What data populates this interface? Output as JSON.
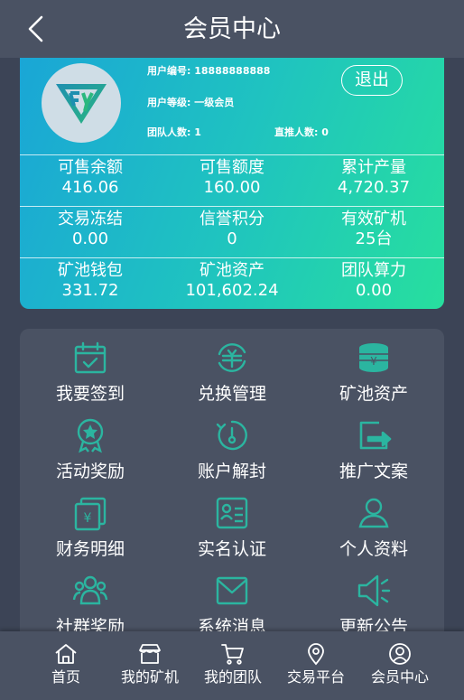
{
  "header": {
    "title": "会员中心"
  },
  "profile": {
    "user_id_label": "用户编号:",
    "user_id": "18888888888",
    "level_label": "用户等级:",
    "level": "一级会员",
    "team_label": "团队人数:",
    "team_count": "1",
    "direct_label": "直推人数:",
    "direct_count": "0",
    "logout_label": "退出"
  },
  "stats": [
    {
      "label": "可售余额",
      "value": "416.06"
    },
    {
      "label": "可售额度",
      "value": "160.00"
    },
    {
      "label": "累计产量",
      "value": "4,720.37"
    },
    {
      "label": "交易冻结",
      "value": "0.00"
    },
    {
      "label": "信誉积分",
      "value": "0"
    },
    {
      "label": "有效矿机",
      "value": "25台"
    },
    {
      "label": "矿池钱包",
      "value": "331.72"
    },
    {
      "label": "矿池资产",
      "value": "101,602.24"
    },
    {
      "label": "团队算力",
      "value": "0.00"
    }
  ],
  "menu": [
    {
      "label": "我要签到",
      "icon": "calendar-check-icon"
    },
    {
      "label": "兑换管理",
      "icon": "exchange-icon"
    },
    {
      "label": "矿池资产",
      "icon": "coin-stack-icon"
    },
    {
      "label": "活动奖励",
      "icon": "medal-icon"
    },
    {
      "label": "账户解封",
      "icon": "unlock-timer-icon"
    },
    {
      "label": "推广文案",
      "icon": "share-icon"
    },
    {
      "label": "财务明细",
      "icon": "finance-icon"
    },
    {
      "label": "实名认证",
      "icon": "id-card-icon"
    },
    {
      "label": "个人资料",
      "icon": "user-icon"
    },
    {
      "label": "社群奖励",
      "icon": "group-icon"
    },
    {
      "label": "系统消息",
      "icon": "mail-icon"
    },
    {
      "label": "更新公告",
      "icon": "speaker-icon"
    }
  ],
  "nav": [
    {
      "label": "首页",
      "icon": "home-icon"
    },
    {
      "label": "我的矿机",
      "icon": "store-icon"
    },
    {
      "label": "我的团队",
      "icon": "cart-icon"
    },
    {
      "label": "交易平台",
      "icon": "location-pin-icon"
    },
    {
      "label": "会员中心",
      "icon": "user-circle-icon"
    }
  ],
  "colors": {
    "accent": "#2bb5a0",
    "background": "#3c4456",
    "panel": "#4a5263",
    "gradient_start": "#1aa6d6",
    "gradient_end": "#27df9e"
  }
}
